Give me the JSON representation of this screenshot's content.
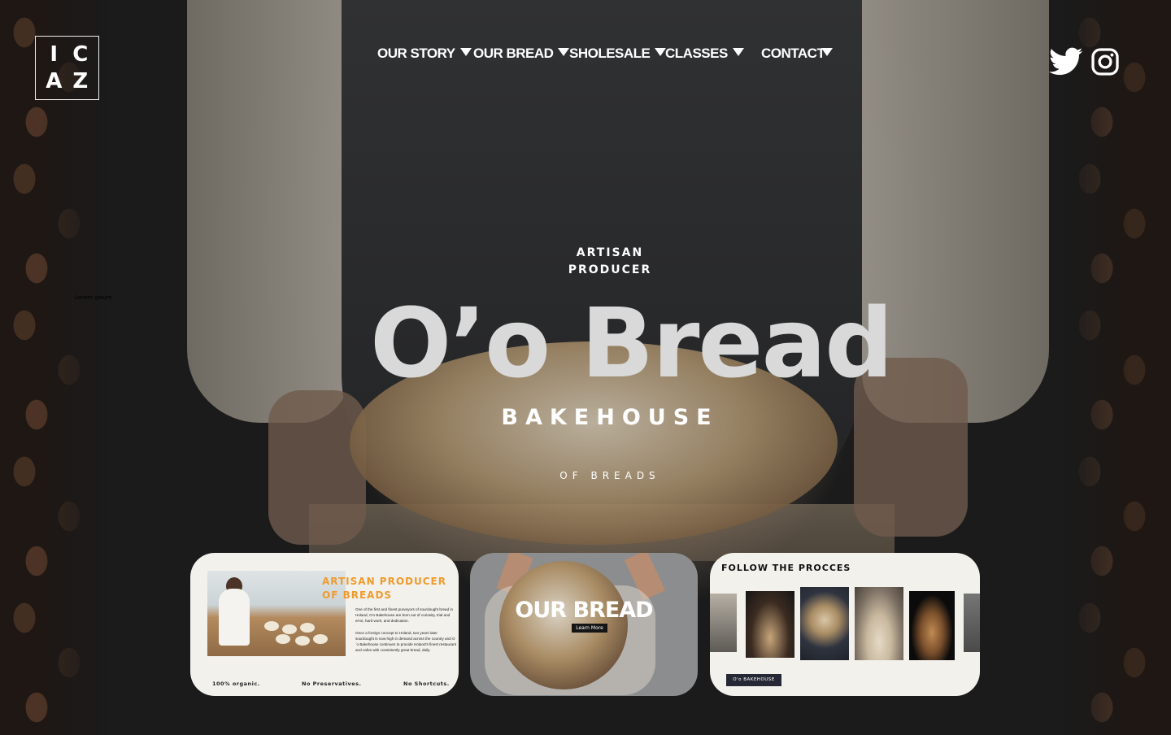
{
  "logo": {
    "letters": [
      "I",
      "C",
      "A",
      "Z"
    ]
  },
  "nav": {
    "items": [
      {
        "label": "OUR STORY"
      },
      {
        "label": "OUR BREAD"
      },
      {
        "label": "SHOLESALE"
      },
      {
        "label": "CLASSES"
      },
      {
        "label": "CONTACT"
      }
    ]
  },
  "social": {
    "icons": [
      "twitter-icon",
      "instagram-icon"
    ]
  },
  "stray_text": "Lorem ipsum",
  "hero": {
    "kicker_line1": "ARTISAN",
    "kicker_line2": "PRODUCER",
    "title": "O’o Bread",
    "subtitle": "BAKEHOUSE",
    "tagline": "OF BREADS"
  },
  "card1": {
    "title_line1": "ARTISAN PRODUCER",
    "title_line2": "OF BREADS",
    "paragraph1": "One of the first and finest purveyors of sourdought bread in Holand, O'o Bakehouse are born out of curiosity, trial and error, hard work, and dedication.",
    "paragraph2": "Once a foreign concept to Holand, two years later sourdought is now high in demand across the country and O´o Bakehouse continues to provide Holand's finest restaurant and cafes with consistently great bread, daily.",
    "features": [
      "100% organic.",
      "No Preservatives.",
      "No Shortcuts."
    ]
  },
  "card2": {
    "title": "OUR BREAD",
    "button": "Learn More"
  },
  "card3": {
    "title": "FOLLOW THE PROCCES",
    "button": "O'o BAKEHOUSE"
  },
  "colors": {
    "accent": "#ef9b2c",
    "background": "#161616",
    "card": "#f2f1ec",
    "button_dark": "#262935"
  }
}
